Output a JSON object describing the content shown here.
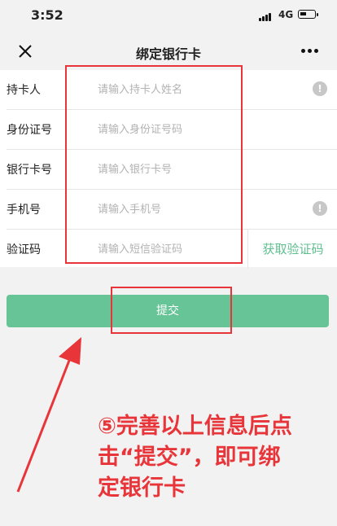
{
  "status_bar": {
    "time": "3:52",
    "network": "4G"
  },
  "nav": {
    "title": "绑定银行卡"
  },
  "form": {
    "rows": [
      {
        "label": "持卡人",
        "placeholder": "请输入持卡人姓名"
      },
      {
        "label": "身份证号",
        "placeholder": "请输入身份证号码"
      },
      {
        "label": "银行卡号",
        "placeholder": "请输入银行卡号"
      },
      {
        "label": "手机号",
        "placeholder": "请输入手机号"
      },
      {
        "label": "验证码",
        "placeholder": "请输入短信验证码"
      }
    ],
    "get_code_label": "获取验证码"
  },
  "submit_label": "提交",
  "annotation": {
    "line1": "⑤完善以上信息后点",
    "line2": "击“提交”，即可绑",
    "line3": "定银行卡"
  },
  "colors": {
    "accent": "#66c497",
    "annotation": "#e8353a"
  }
}
